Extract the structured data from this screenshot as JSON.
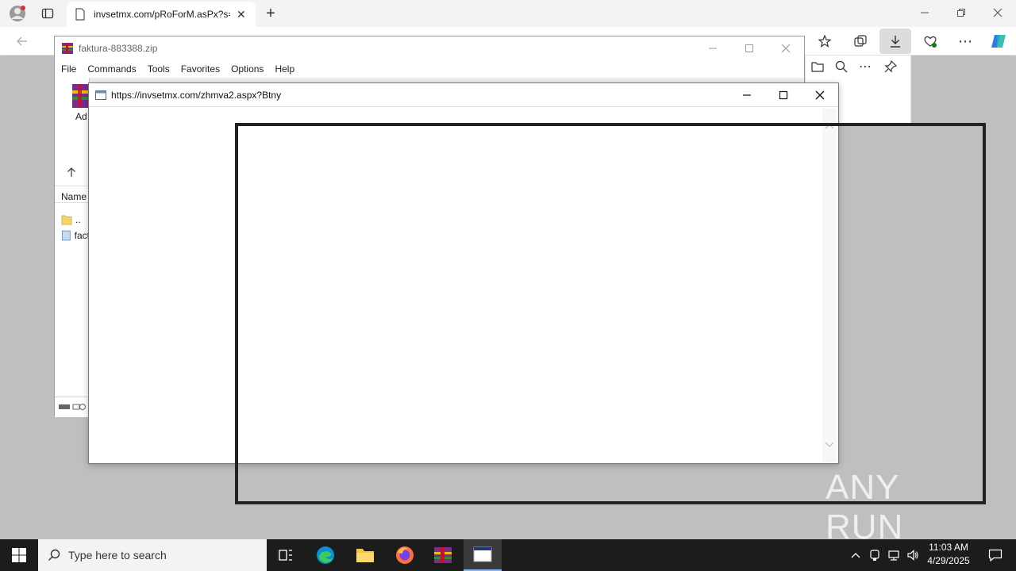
{
  "edge": {
    "tab_title": "invsetmx.com/pRoForM.asPx?s=",
    "new_tab": "+"
  },
  "rar": {
    "title": "faktura-883388.zip",
    "menu": [
      "File",
      "Commands",
      "Tools",
      "Favorites",
      "Options",
      "Help"
    ],
    "toolbar_label": "Ad",
    "column_name": "Name",
    "files": [
      {
        "name": ".."
      },
      {
        "name": "fact"
      }
    ]
  },
  "popup": {
    "url": "https://invsetmx.com/zhmva2.aspx?Btny"
  },
  "watermark": "ANY RUN",
  "taskbar": {
    "search_placeholder": "Type here to search",
    "time": "11:03 AM",
    "date": "4/29/2025"
  },
  "colors": {
    "accent": "#0078d4",
    "download_highlight": "#dcdcdc",
    "outline": "#222222"
  }
}
